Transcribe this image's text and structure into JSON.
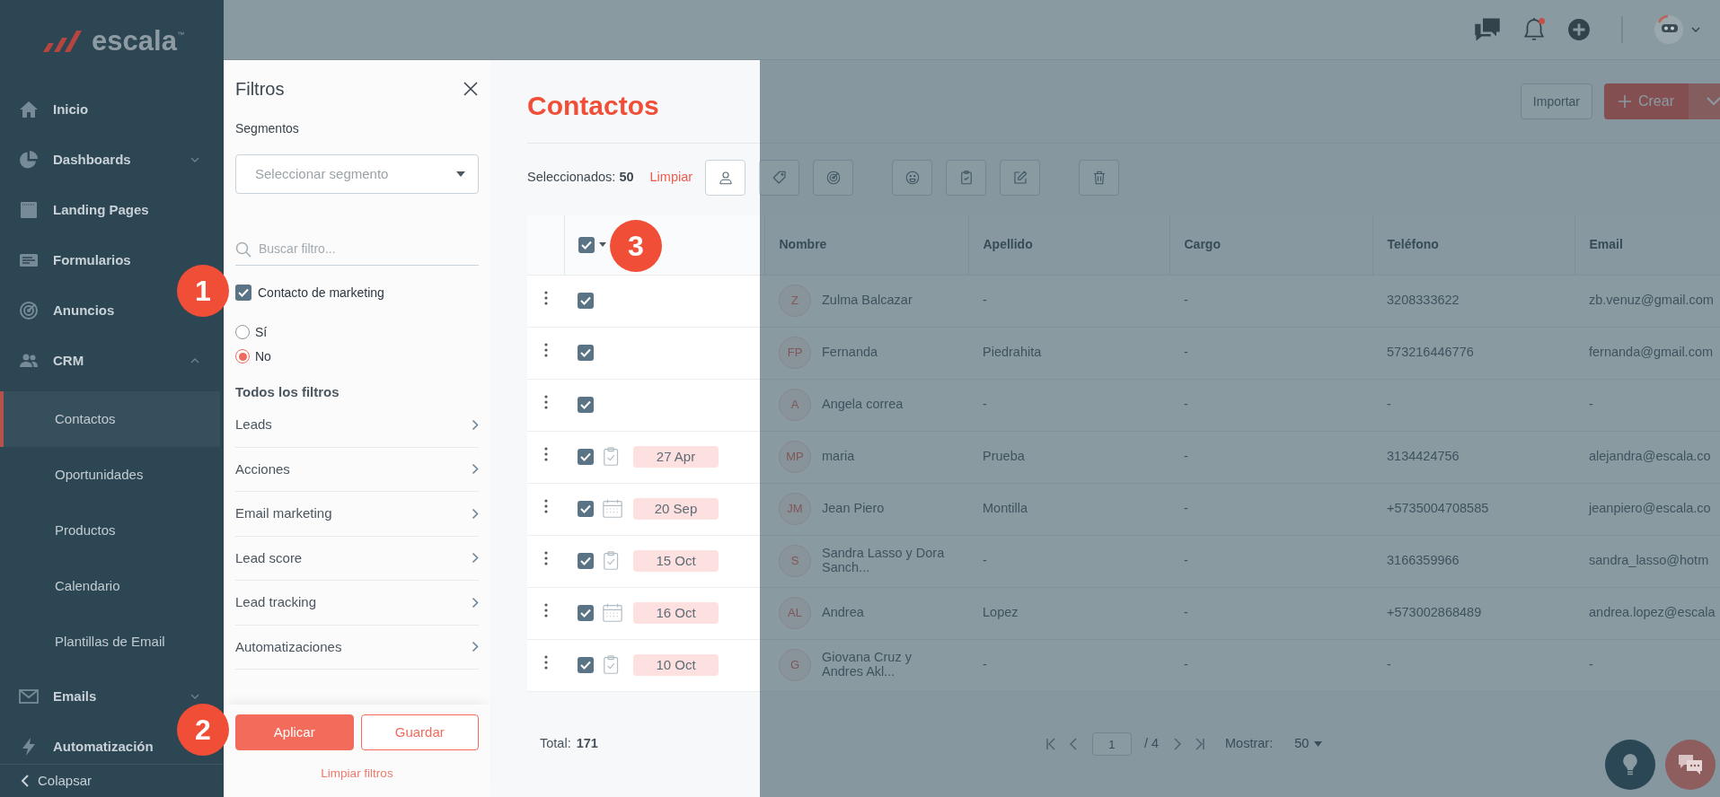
{
  "sidebar": {
    "logo": "escala$^{™}$",
    "items": [
      {
        "label": "Inicio"
      },
      {
        "label": "Dashboards",
        "expanded": false
      },
      {
        "label": "Landing Pages"
      },
      {
        "label": "Formularios"
      },
      {
        "label": "Anuncios"
      },
      {
        "label": "CRM",
        "expanded": true,
        "children": [
          {
            "label": "Contactos",
            "selected": true
          },
          {
            "label": "Oportunidades",
            "selected": false
          },
          {
            "label": "Productos",
            "selected": false
          },
          {
            "label": "Calendario",
            "selected": false
          },
          {
            "label": "Plantillas de Email",
            "selected": false
          }
        ]
      },
      {
        "label": "Emails",
        "expanded": false
      },
      {
        "label": "Automatización"
      }
    ],
    "collapse": "Colapsar"
  },
  "topbar": {
    "unread": true
  },
  "filters": {
    "title": "Filtros",
    "segment_label": "Segmentos",
    "segment_placeholder": "Seleccionar segmento",
    "search_placeholder": "Buscar filtro...",
    "marketing": {
      "label": "Contacto de marketing",
      "checked": true,
      "options": [
        {
          "label": "Sí",
          "selected": false
        },
        {
          "label": "No",
          "selected": true
        }
      ]
    },
    "all_filters_title": "Todos los filtros",
    "groups": [
      "Leads",
      "Acciones",
      "Email marketing",
      "Lead score",
      "Lead tracking",
      "Automatizaciones"
    ],
    "apply": "Aplicar",
    "save": "Guardar",
    "clear": "Limpiar filtros"
  },
  "main": {
    "title": "Contactos",
    "import": "Importar",
    "create": "Crear",
    "selection": "Seleccionados: **50**",
    "clear_selection": "Limpiar",
    "table": {
      "header_checked": true,
      "columns": [
        "Nombre",
        "Apellido",
        "Cargo",
        "Teléfono",
        "Email"
      ],
      "rows": [
        {
          "checked": true,
          "initials": "Z",
          "name": "Zulma Balcazar",
          "last_name": "-",
          "position": "-",
          "phone": "3208333622",
          "email": "zb.venuz@gmail.com"
        },
        {
          "checked": true,
          "initials": "FP",
          "name": "Fernanda",
          "last_name": "Piedrahita",
          "position": "-",
          "phone": "573216446776",
          "email": "fernanda@gmail.com"
        },
        {
          "checked": true,
          "initials": "A",
          "name": "Angela correa",
          "last_name": "-",
          "position": "-",
          "phone": "-",
          "email": "-"
        },
        {
          "checked": true,
          "activity": {
            "kind": "task",
            "date": "27 Apr"
          },
          "initials": "MP",
          "name": "maria",
          "last_name": "Prueba",
          "position": "-",
          "phone": "3134424756",
          "email": "alejandra@escala.co"
        },
        {
          "checked": true,
          "activity": {
            "kind": "event",
            "date": "20 Sep"
          },
          "initials": "JM",
          "name": "Jean Piero",
          "last_name": "Montilla",
          "position": "-",
          "phone": "+5735004708585",
          "email": "jeanpiero@escala.co"
        },
        {
          "checked": true,
          "activity": {
            "kind": "task",
            "date": "15 Oct"
          },
          "initials": "S",
          "name": "Sandra Lasso y Dora Sanch...",
          "last_name": "-",
          "position": "-",
          "phone": "3166359966",
          "email": "sandra_lasso@hotm"
        },
        {
          "checked": true,
          "activity": {
            "kind": "event",
            "date": "16 Oct"
          },
          "initials": "AL",
          "name": "Andrea",
          "last_name": "Lopez",
          "position": "-",
          "phone": "+573002868489",
          "email": "andrea.lopez@escala"
        },
        {
          "checked": true,
          "activity": {
            "kind": "task",
            "date": "10 Oct"
          },
          "initials": "G",
          "name": "Giovana Cruz y Andres Akl...",
          "last_name": "-",
          "position": "-",
          "phone": "-",
          "email": "-"
        }
      ]
    },
    "footer": {
      "total_label": "Total:",
      "total": "171",
      "page": "1",
      "pages": "/ 4",
      "show_label": "Mostrar:",
      "page_size": "50"
    }
  },
  "callouts": [
    "1",
    "2",
    "3"
  ]
}
